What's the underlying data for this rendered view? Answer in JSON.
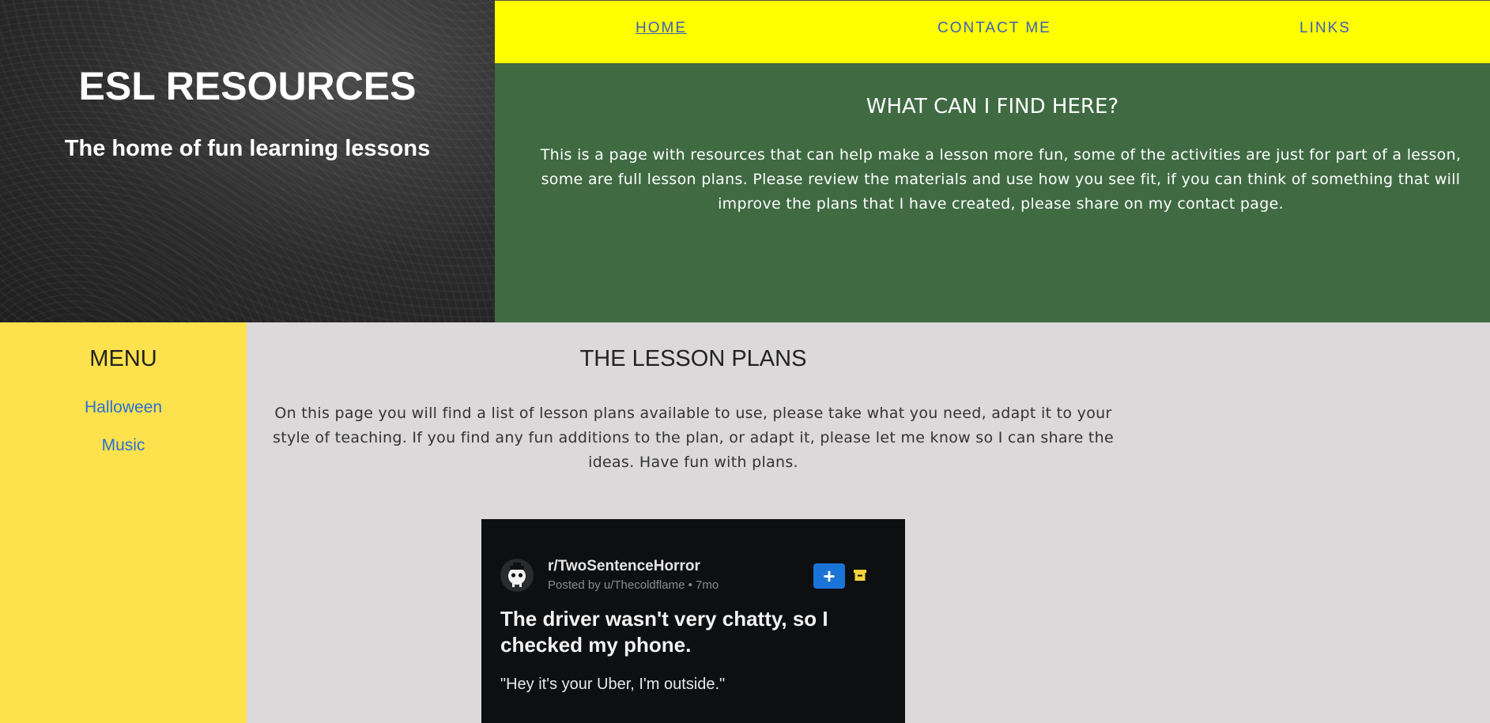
{
  "hero": {
    "title": "ESL RESOURCES",
    "subtitle": "The home of fun learning lessons"
  },
  "nav": {
    "items": [
      {
        "label": "HOME",
        "active": true
      },
      {
        "label": "CONTACT ME",
        "active": false
      },
      {
        "label": "LINKS",
        "active": false
      }
    ]
  },
  "info": {
    "heading": "WHAT CAN I FIND HERE?",
    "text": "This is a page with resources that can help make a lesson more fun, some of the activities are just for part of a lesson, some are full lesson plans. Please review the materials and use how you see fit, if you can think of something that will improve the plans that I have created, please share on my contact page."
  },
  "sidebar": {
    "heading": "MENU",
    "links": [
      "Halloween",
      "Music"
    ]
  },
  "main": {
    "heading": "THE LESSON PLANS",
    "text": "On this page you will find a list of lesson plans available to use, please take what you need, adapt it to your style of teaching. If you find any fun additions to the plan, or adapt it, please let me know so I can share the ideas. Have fun with plans."
  },
  "post": {
    "subreddit": "r/TwoSentenceHorror",
    "meta": "Posted by u/Thecoldflame • 7mo",
    "headline": "The driver wasn't very chatty, so I checked my phone.",
    "quote": "\"Hey it's your Uber, I'm outside.\"",
    "plus": "+",
    "icons": [
      "reddit-avatar-icon",
      "plus-icon",
      "archive-icon"
    ]
  },
  "colors": {
    "nav_bg": "#ffff00",
    "nav_link": "#3c5fbd",
    "info_bg": "#3f6a42",
    "sidebar_bg": "#fee24d",
    "sidebar_link": "#2a6fd6",
    "main_bg": "#dbd9da"
  }
}
